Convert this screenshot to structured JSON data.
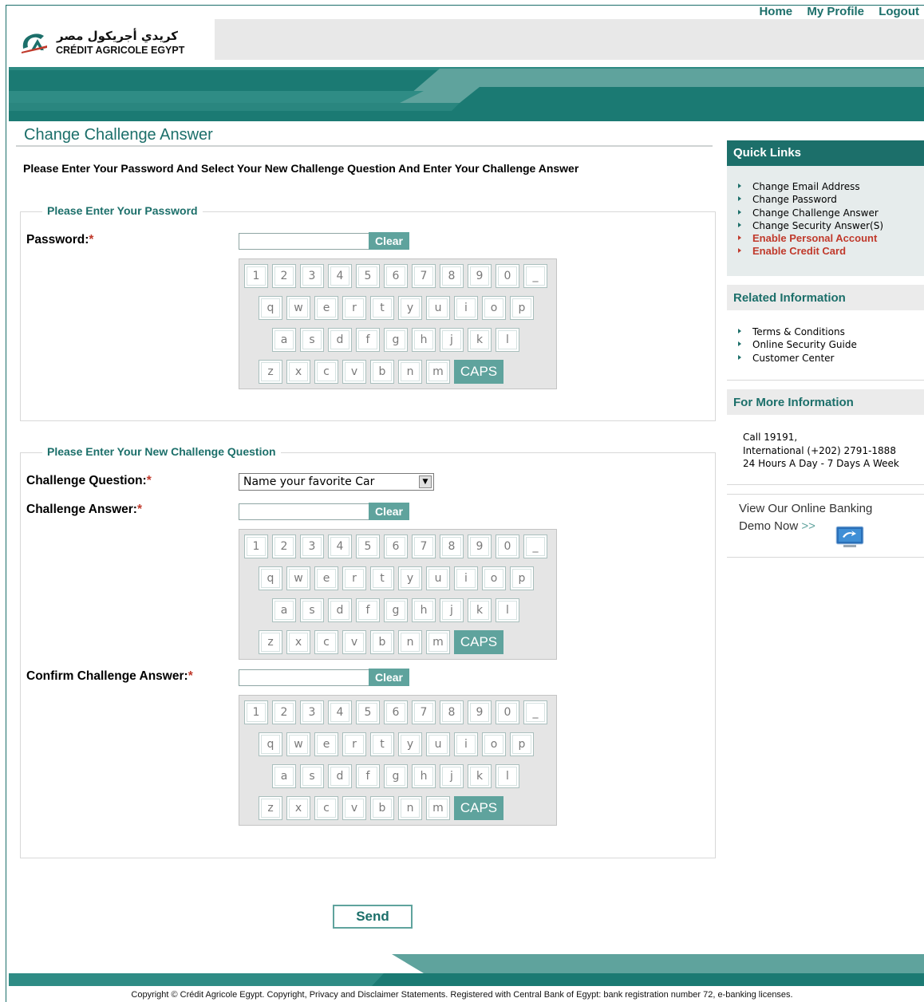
{
  "top_nav": {
    "home": "Home",
    "profile": "My Profile",
    "logout": "Logout"
  },
  "brand": {
    "arabic": "كريدي أجريكول مصر",
    "latin": "CRÉDIT AGRICOLE EGYPT"
  },
  "page": {
    "title": "Change Challenge Answer",
    "instruction": "Please Enter Your Password And Select Your New Challenge Question And Enter Your Challenge Answer"
  },
  "password_section": {
    "legend": "Please Enter Your Password",
    "label": "Password:",
    "required_mark": "*"
  },
  "question_section": {
    "legend": "Please Enter Your New Challenge Question",
    "question_label": "Challenge Question:",
    "question_value": "Name your favorite Car",
    "answer_label": "Challenge Answer:",
    "confirm_label": "Confirm Challenge Answer:",
    "required_mark": "*"
  },
  "clear_label": "Clear",
  "keyboard": {
    "row1": [
      "1",
      "2",
      "3",
      "4",
      "5",
      "6",
      "7",
      "8",
      "9",
      "0",
      "_"
    ],
    "row2": [
      "q",
      "w",
      "e",
      "r",
      "t",
      "y",
      "u",
      "i",
      "o",
      "p"
    ],
    "row3": [
      "a",
      "s",
      "d",
      "f",
      "g",
      "h",
      "j",
      "k",
      "l"
    ],
    "row4": [
      "z",
      "x",
      "c",
      "v",
      "b",
      "n",
      "m"
    ],
    "caps": "CAPS"
  },
  "send_label": "Send",
  "quick_links": {
    "title": "Quick Links",
    "items": [
      {
        "label": "Change Email Address",
        "style": "normal"
      },
      {
        "label": "Change Password",
        "style": "normal"
      },
      {
        "label": "Change Challenge Answer",
        "style": "normal"
      },
      {
        "label": "Change Security Answer(S)",
        "style": "normal"
      },
      {
        "label": "Enable Personal Account",
        "style": "red"
      },
      {
        "label": "Enable Credit Card",
        "style": "red"
      }
    ]
  },
  "related_info": {
    "title": "Related Information",
    "items": [
      "Terms & Conditions",
      "Online Security Guide",
      "Customer Center"
    ]
  },
  "more_info": {
    "title": "For More Information",
    "line1": "Call 19191,",
    "line2": "International (+202) 2791-1888",
    "line3": "24 Hours A Day - 7 Days A Week"
  },
  "demo": {
    "line1": "View Our Online Banking",
    "line2": "Demo Now",
    "arrow": ">>"
  },
  "footer": {
    "copyright": "Copyright © Crédit Agricole Egypt. Copyright, Privacy and Disclaimer Statements. Registered with Central Bank of Egypt: bank registration number 72, e-banking licenses."
  },
  "colors": {
    "brand_teal": "#1c6f6a",
    "button_teal": "#5fa39d",
    "alert_red": "#c0392b"
  }
}
